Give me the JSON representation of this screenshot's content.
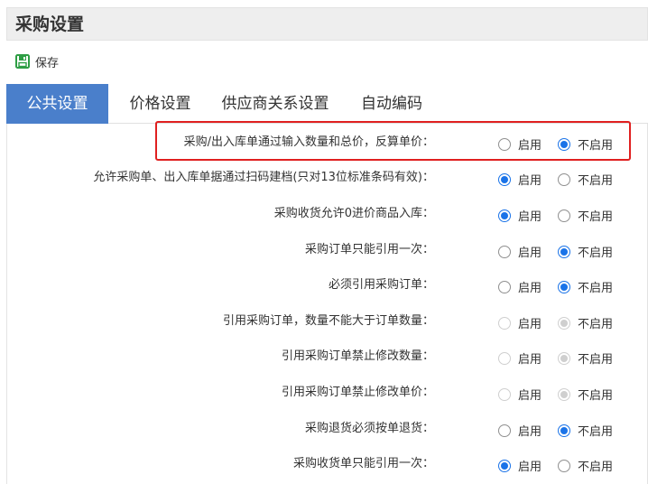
{
  "window": {
    "title": "采购设置"
  },
  "toolbar": {
    "save_label": "保存",
    "save_icon": "save-icon"
  },
  "tabs": [
    {
      "label": "公共设置",
      "active": true
    },
    {
      "label": "价格设置",
      "active": false
    },
    {
      "label": "供应商关系设置",
      "active": false
    },
    {
      "label": "自动编码",
      "active": false
    }
  ],
  "options": {
    "enable_label": "启用",
    "disable_label": "不启用"
  },
  "settings": [
    {
      "label": "采购/出入库单通过输入数量和总价，反算单价：",
      "value": "不启用",
      "disabled": false,
      "highlighted": true
    },
    {
      "label": "允许采购单、出入库单据通过扫码建档(只对13位标准条码有效)：",
      "value": "启用",
      "disabled": false,
      "highlighted": false
    },
    {
      "label": "采购收货允许0进价商品入库：",
      "value": "启用",
      "disabled": false,
      "highlighted": false
    },
    {
      "label": "采购订单只能引用一次：",
      "value": "不启用",
      "disabled": false,
      "highlighted": false
    },
    {
      "label": "必须引用采购订单：",
      "value": "不启用",
      "disabled": false,
      "highlighted": false
    },
    {
      "label": "引用采购订单，数量不能大于订单数量：",
      "value": "不启用",
      "disabled": true,
      "highlighted": false
    },
    {
      "label": "引用采购订单禁止修改数量：",
      "value": "不启用",
      "disabled": true,
      "highlighted": false
    },
    {
      "label": "引用采购订单禁止修改单价：",
      "value": "不启用",
      "disabled": true,
      "highlighted": false
    },
    {
      "label": "采购退货必须按单退货：",
      "value": "不启用",
      "disabled": false,
      "highlighted": false
    },
    {
      "label": "采购收货单只能引用一次：",
      "value": "启用",
      "disabled": false,
      "highlighted": false
    }
  ],
  "colors": {
    "accent": "#4a7fcb",
    "radio_checked": "#1a73e8",
    "highlight": "#e02020",
    "disabled": "#cfcfcf"
  }
}
